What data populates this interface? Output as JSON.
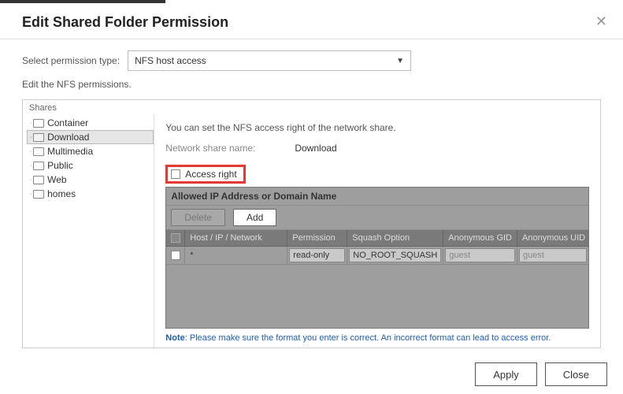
{
  "dialog": {
    "title": "Edit Shared Folder Permission"
  },
  "permtype": {
    "label": "Select permission type:",
    "value": "NFS host access"
  },
  "subtext": "Edit the NFS permissions.",
  "shares": {
    "panel_label": "Shares",
    "items": [
      {
        "label": "Container"
      },
      {
        "label": "Download",
        "selected": true
      },
      {
        "label": "Multimedia"
      },
      {
        "label": "Public"
      },
      {
        "label": "Web"
      },
      {
        "label": "homes"
      }
    ]
  },
  "right": {
    "intro": "You can set the NFS access right of the network share.",
    "name_label": "Network share name:",
    "name_value": "Download",
    "access_right_label": "Access right"
  },
  "grid": {
    "title": "Allowed IP Address or Domain Name",
    "delete_label": "Delete",
    "add_label": "Add",
    "cols": {
      "host": "Host / IP / Network",
      "perm": "Permission",
      "squash": "Squash Option",
      "agid": "Anonymous GID",
      "auid": "Anonymous UID"
    },
    "rows": [
      {
        "host": "*",
        "perm": "read-only",
        "squash": "NO_ROOT_SQUASH",
        "agid": "guest",
        "auid": "guest"
      }
    ]
  },
  "note": {
    "prefix": "Note",
    "text": ": Please make sure the format you enter is correct. An incorrect format can lead to access error."
  },
  "footer": {
    "apply": "Apply",
    "close": "Close"
  }
}
